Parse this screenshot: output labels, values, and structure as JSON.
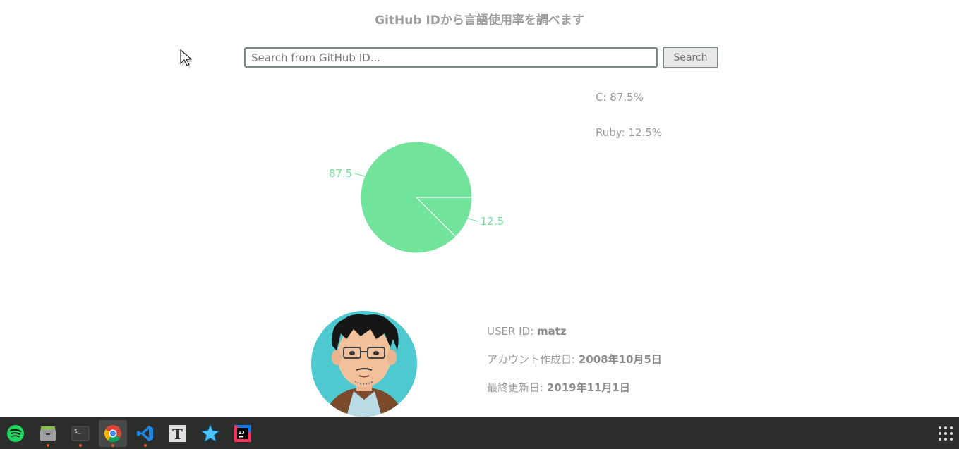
{
  "page": {
    "title": "GitHub IDから言語使用率を調べます"
  },
  "search": {
    "placeholder": "Search from GitHub ID...",
    "button_label": "Search"
  },
  "legend": [
    {
      "label": "C: 87.5%"
    },
    {
      "label": "Ruby: 12.5%"
    }
  ],
  "chart_data": {
    "type": "pie",
    "categories": [
      "C",
      "Ruby"
    ],
    "values": [
      87.5,
      12.5
    ],
    "data_labels": [
      "87.5",
      "12.5"
    ],
    "color": "#72e39a"
  },
  "user": {
    "id_label": "USER ID: ",
    "id_value": "matz",
    "created_label": "アカウント作成日: ",
    "created_value": "2008年10月5日",
    "updated_label": "最終更新日: ",
    "updated_value": "2019年11月1日"
  },
  "taskbar": {
    "items": [
      {
        "icon": "spotify-icon"
      },
      {
        "icon": "file-manager-icon"
      },
      {
        "icon": "terminal-icon"
      },
      {
        "icon": "chrome-icon"
      },
      {
        "icon": "vscode-icon"
      },
      {
        "icon": "typora-icon"
      },
      {
        "icon": "star-app-icon"
      },
      {
        "icon": "intellij-icon"
      }
    ],
    "apps_icon": "apps-grid-icon"
  }
}
